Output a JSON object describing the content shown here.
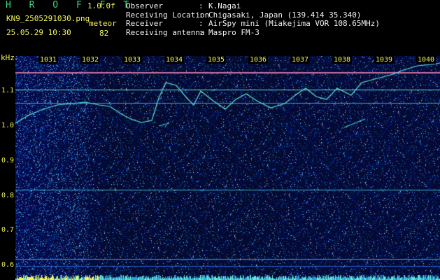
{
  "header": {
    "app_title": "H R O F F T",
    "version": "1.0.0f",
    "file_name": "KN9_2505291030.png",
    "datetime": "25.05.29 10:30",
    "meteor_label": "meteor",
    "meteor_count": "82"
  },
  "info": [
    {
      "key": "Observer",
      "value": "K.Nagai"
    },
    {
      "key": "Receiving Location",
      "value": "Chigasaki, Japan (139.414 35.340)"
    },
    {
      "key": "Receiver",
      "value": "AirSpy mini (Miakejima VOR 108.65MHz)"
    },
    {
      "key": "Receiving antenna",
      "value": "Maspro FM-3"
    }
  ],
  "axis": {
    "unit": "kHz",
    "y_ticks": [
      "1.1",
      "1.0",
      "0.9",
      "0.8",
      "0.7",
      "0.6"
    ],
    "time_ticks": [
      "1031",
      "1032",
      "1033",
      "1034",
      "1035",
      "1036",
      "1037",
      "1038",
      "1039",
      "1040"
    ]
  },
  "colors": {
    "background": "#000000",
    "label_yellow": "#f2f25a",
    "title_green": "#39d97a",
    "spectrum_base": "#07107a",
    "trace_cyan": "#5ee8d6"
  }
}
